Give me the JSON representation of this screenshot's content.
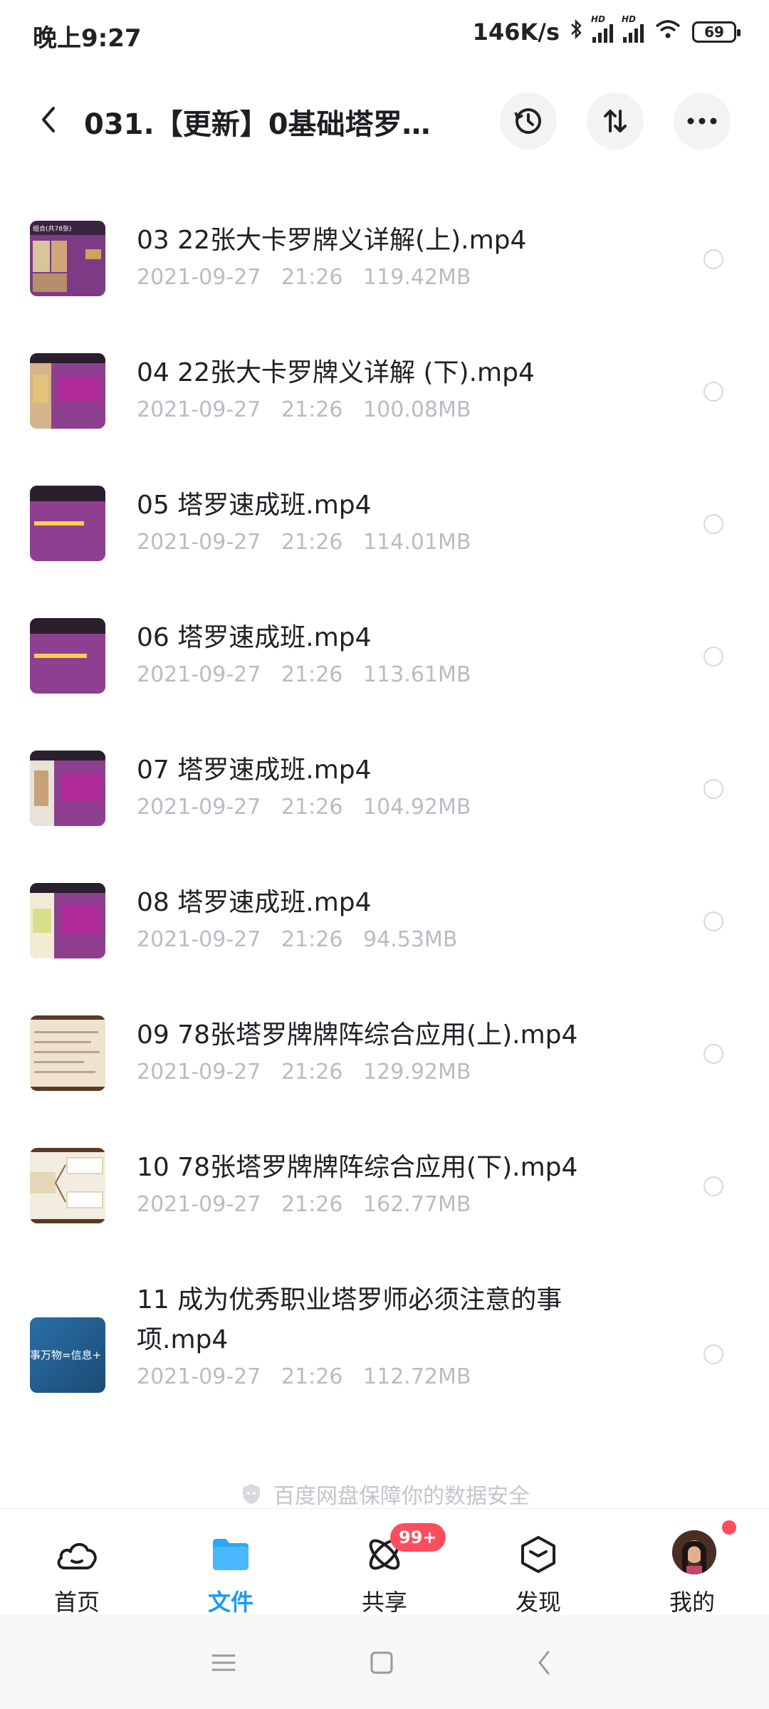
{
  "status": {
    "time": "晚上9:27",
    "speed": "146K/s",
    "battery": "69"
  },
  "header": {
    "title": "031.【更新】0基础塔罗…"
  },
  "files": [
    {
      "name": "03 22张大卡罗牌义详解(上).mp4",
      "date": "2021-09-27",
      "time": "21:26",
      "size": "119.42MB",
      "thumb": "A"
    },
    {
      "name": "04 22张大卡罗牌义详解 (下).mp4",
      "date": "2021-09-27",
      "time": "21:26",
      "size": "100.08MB",
      "thumb": "B"
    },
    {
      "name": "05 塔罗速成班.mp4",
      "date": "2021-09-27",
      "time": "21:26",
      "size": "114.01MB",
      "thumb": "C"
    },
    {
      "name": "06 塔罗速成班.mp4",
      "date": "2021-09-27",
      "time": "21:26",
      "size": "113.61MB",
      "thumb": "C"
    },
    {
      "name": "07 塔罗速成班.mp4",
      "date": "2021-09-27",
      "time": "21:26",
      "size": "104.92MB",
      "thumb": "B"
    },
    {
      "name": "08 塔罗速成班.mp4",
      "date": "2021-09-27",
      "time": "21:26",
      "size": "94.53MB",
      "thumb": "B"
    },
    {
      "name": "09 78张塔罗牌牌阵综合应用(上).mp4",
      "date": "2021-09-27",
      "time": "21:26",
      "size": "129.92MB",
      "thumb": "D"
    },
    {
      "name": "10 78张塔罗牌牌阵综合应用(下).mp4",
      "date": "2021-09-27",
      "time": "21:26",
      "size": "162.77MB",
      "thumb": "E"
    },
    {
      "name": "11 成为优秀职业塔罗师必须注意的事项.mp4",
      "date": "2021-09-27",
      "time": "21:26",
      "size": "112.72MB",
      "thumb": "F"
    }
  ],
  "thumbs": {
    "A": {
      "text": "组合(共78张)"
    },
    "F": {
      "text": "事万物=信息+"
    }
  },
  "security_note": "百度网盘保障你的数据安全",
  "tabs": [
    {
      "label": "首页",
      "icon": "cloud-icon"
    },
    {
      "label": "文件",
      "icon": "folder-icon",
      "active": true
    },
    {
      "label": "共享",
      "icon": "atom-icon",
      "badge": "99+"
    },
    {
      "label": "发现",
      "icon": "cube-icon"
    },
    {
      "label": "我的",
      "icon": "avatar"
    }
  ],
  "colors": {
    "accent": "#1a9bf5",
    "badge": "#ff4d5e",
    "thumb_purple": "#8e3f8f",
    "meta_gray": "#b9bcc2"
  }
}
